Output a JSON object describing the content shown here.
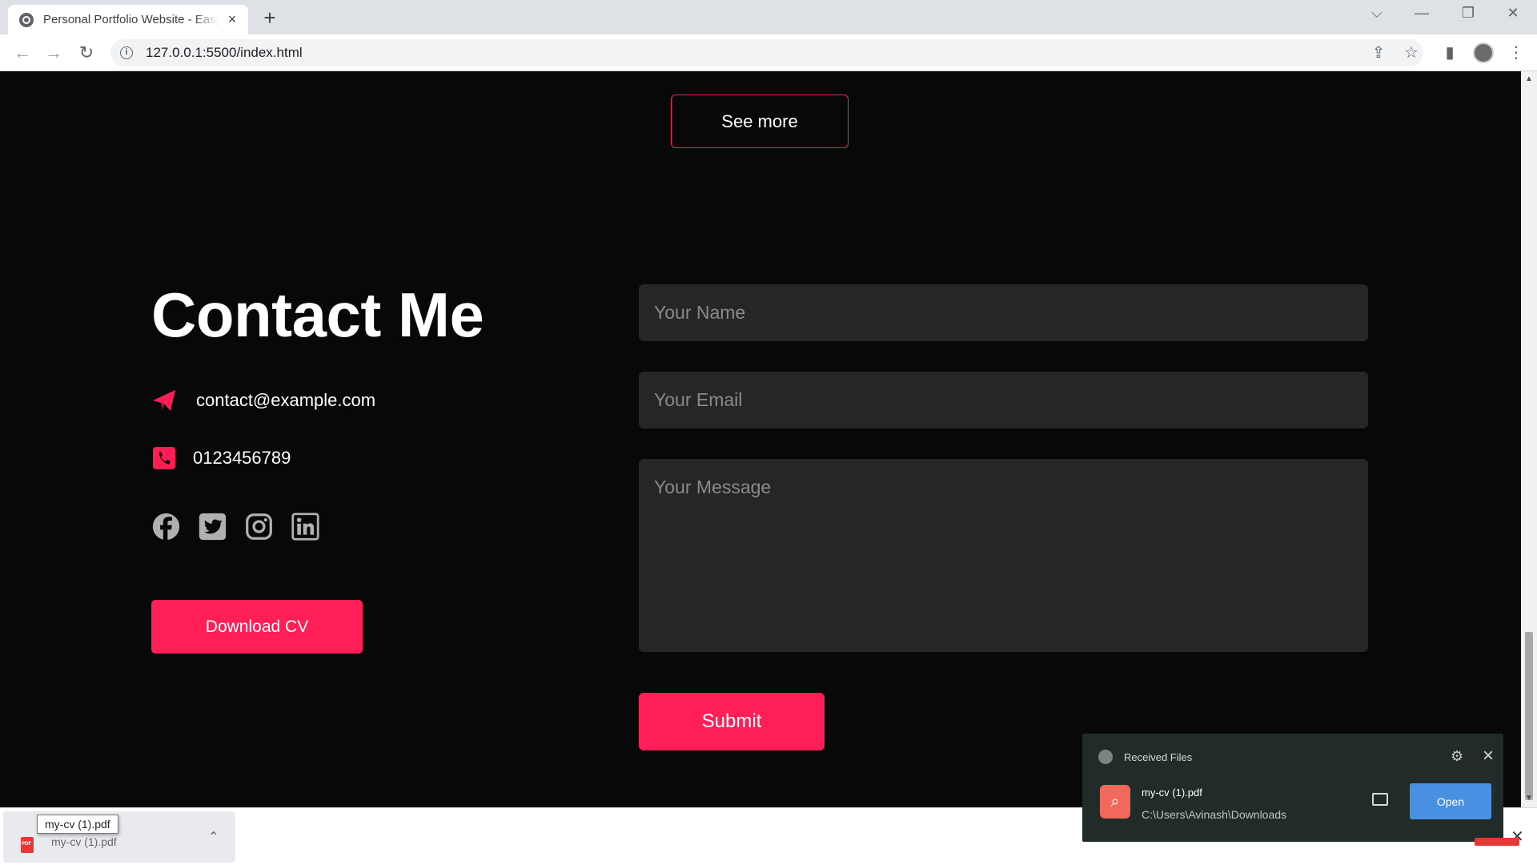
{
  "browser": {
    "tab_title": "Personal Portfolio Website - Easy",
    "url": "127.0.0.1:5500/index.html"
  },
  "page": {
    "see_more_label": "See more",
    "contact": {
      "title": "Contact Me",
      "email": "contact@example.com",
      "phone": "0123456789",
      "download_label": "Download CV",
      "socials": [
        "facebook",
        "twitter",
        "instagram",
        "linkedin"
      ]
    },
    "form": {
      "name_placeholder": "Your Name",
      "email_placeholder": "Your Email",
      "message_placeholder": "Your Message",
      "submit_label": "Submit"
    },
    "colors": {
      "accent": "#ff1e56",
      "background": "#080808",
      "field": "#262626"
    }
  },
  "download_shelf": {
    "file_name": "my-cv (1).pdf",
    "tooltip": "my-cv (1).pdf"
  },
  "popup": {
    "title": "Received Files",
    "file_name": "my-cv (1).pdf",
    "file_path": "C:\\Users\\Avinash\\Downloads",
    "open_label": "Open"
  }
}
